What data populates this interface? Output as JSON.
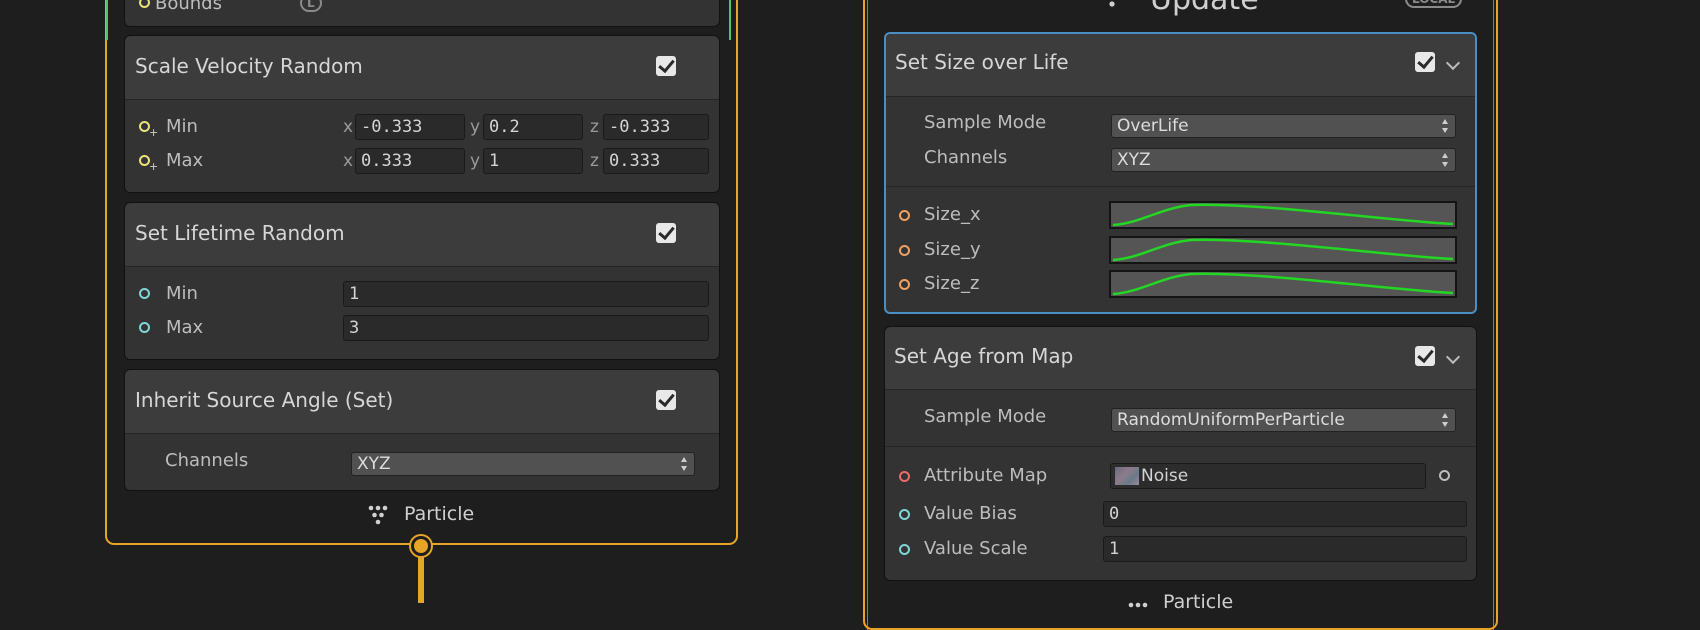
{
  "contexts": {
    "left": {
      "partial_top_label": "Bounds",
      "partial_top_badge": "L",
      "footer": "Particle"
    },
    "right": {
      "title": "Update",
      "title_badge": "LOCAL",
      "footer": "Particle"
    }
  },
  "blocks": {
    "scale_velocity": {
      "title": "Scale Velocity Random",
      "rows": [
        {
          "label": "Min",
          "x": "-0.333",
          "y": "0.2",
          "z": "-0.333"
        },
        {
          "label": "Max",
          "x": "0.333",
          "y": "1",
          "z": "0.333"
        }
      ],
      "axes": {
        "x": "x",
        "y": "y",
        "z": "z"
      }
    },
    "lifetime": {
      "title": "Set Lifetime Random",
      "rows": [
        {
          "label": "Min",
          "value": "1"
        },
        {
          "label": "Max",
          "value": "3"
        }
      ]
    },
    "inherit_angle": {
      "title": "Inherit Source Angle (Set)",
      "channels_label": "Channels",
      "channels_value": "XYZ"
    },
    "size_over_life": {
      "title": "Set Size over Life",
      "sample_mode_label": "Sample Mode",
      "sample_mode_value": "OverLife",
      "channels_label": "Channels",
      "channels_value": "XYZ",
      "curves": [
        {
          "label": "Size_x"
        },
        {
          "label": "Size_y"
        },
        {
          "label": "Size_z"
        }
      ],
      "curve_color": "#22d822"
    },
    "age_from_map": {
      "title": "Set Age from Map",
      "sample_mode_label": "Sample Mode",
      "sample_mode_value": "RandomUniformPerParticle",
      "attribute_map_label": "Attribute Map",
      "attribute_map_value": "Noise",
      "value_bias_label": "Value Bias",
      "value_bias": "0",
      "value_scale_label": "Value Scale",
      "value_scale": "1"
    }
  },
  "colors": {
    "flow_edge": "#e6a526",
    "selection": "#4a8fc4",
    "vector_port": "#e8e27a",
    "float_port": "#7fd6d6",
    "curve_port": "#f0a060",
    "texture_port": "#ec6a6a"
  }
}
